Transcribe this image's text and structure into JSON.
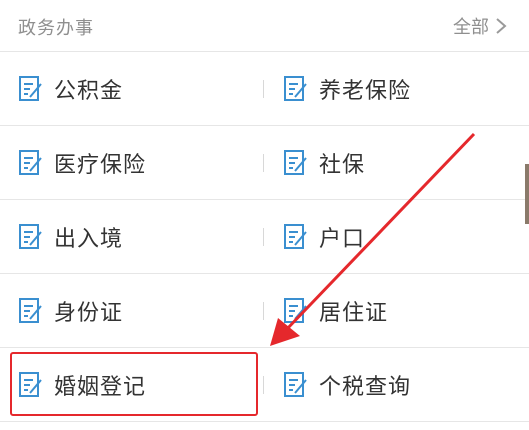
{
  "header": {
    "title": "政务办事",
    "more_label": "全部"
  },
  "rows": [
    {
      "left": "公积金",
      "right": "养老保险"
    },
    {
      "left": "医疗保险",
      "right": "社保"
    },
    {
      "left": "出入境",
      "right": "户口"
    },
    {
      "left": "身份证",
      "right": "居住证"
    },
    {
      "left": "婚姻登记",
      "right": "个税查询"
    }
  ],
  "annotation": {
    "highlighted_item": "婚姻登记",
    "color": "#e5282c"
  },
  "colors": {
    "icon": "#3a8fd0",
    "text": "#333333",
    "muted": "#8f8f8f"
  }
}
